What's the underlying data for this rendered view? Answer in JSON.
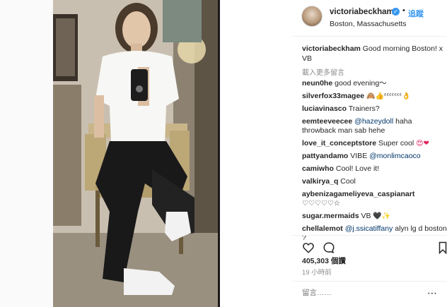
{
  "post": {
    "username": "victoriabeckham",
    "follow_label": "追蹤",
    "location": "Boston, Massachusetts",
    "caption_user": "victoriabeckham",
    "caption_text": "Good morning Boston! x VB",
    "load_more": "載入更多留言"
  },
  "comments": [
    {
      "user": "neun0he",
      "text": "good evening〜"
    },
    {
      "user": "silverfox33magee",
      "text": "🙈👍ᵋᵋᵋᵋᵋᵋᵋ👌"
    },
    {
      "user": "luciavinasco",
      "text": "Trainers?"
    },
    {
      "user": "eemteeveecee",
      "mention": "@hazeydoll",
      "text": "haha throwback man sab hehe"
    },
    {
      "user": "love_it_conceptstore",
      "text": "Super cool",
      "emoji": "😍❤"
    },
    {
      "user": "pattyandamo",
      "text": "VIBE",
      "mention": "@monlimcaoco"
    },
    {
      "user": "camiwho",
      "text": "Cool! Love it!"
    },
    {
      "user": "valkirya_q",
      "text": "Cool"
    },
    {
      "user": "aybenizagameliyeva_caspianart",
      "text": "♡♡♡♡♡☆"
    },
    {
      "user": "sugar.mermaids",
      "text": "VB",
      "emoji": "🖤✨"
    },
    {
      "user": "chellalemot",
      "mention": "@j.ssicatiffany",
      "text": "alyn lg d boston ?"
    }
  ],
  "footer": {
    "likes": "405,303 個讚",
    "time": "19 小時前",
    "add_comment_placeholder": "留言……",
    "more": "⋯"
  },
  "icons": {
    "verified": "verified-badge-icon",
    "heart": "heart-icon",
    "comment": "comment-icon",
    "bookmark": "bookmark-icon"
  },
  "colors": {
    "link_blue": "#3897f0",
    "mention_blue": "#003569",
    "muted_gray": "#8e8e8e",
    "text": "#262626"
  }
}
